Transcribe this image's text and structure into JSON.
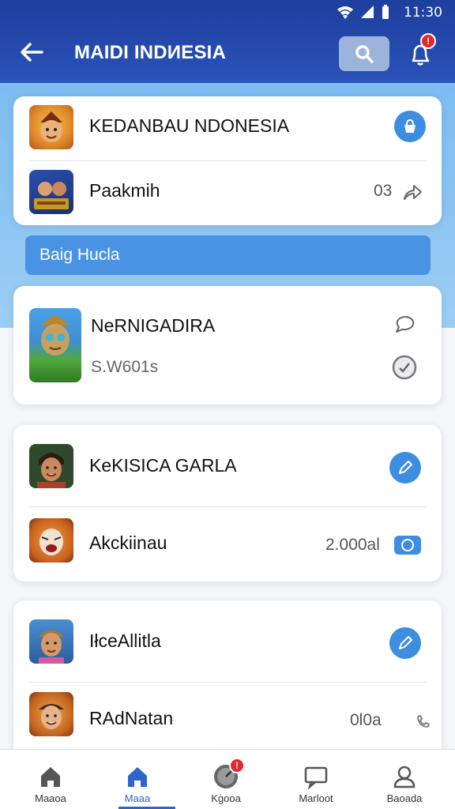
{
  "status_bar": {
    "time": "11:30"
  },
  "header": {
    "title": "MAIDI INDИESIA",
    "notification_count": "!"
  },
  "card1": {
    "rows": [
      {
        "title": "KEDANBAU NDONESIA",
        "value": ""
      },
      {
        "title": "Paakmih",
        "value": "03"
      }
    ]
  },
  "section": {
    "label": "Baig Hucla"
  },
  "card2": {
    "rows": [
      {
        "title": "NeRNIGADIRA",
        "value": ""
      },
      {
        "title": "S.W601s",
        "value": ""
      }
    ]
  },
  "card3": {
    "rows": [
      {
        "title": "KeKISICA GARLA",
        "value": ""
      },
      {
        "title": "Akckiinau",
        "value": "2.000al"
      }
    ]
  },
  "card4": {
    "rows": [
      {
        "title": "IłceAllitla",
        "value": ""
      },
      {
        "title": "RAdNatan",
        "value": "0l0a"
      }
    ]
  },
  "nav": {
    "items": [
      {
        "label": "Maaoa"
      },
      {
        "label": "Maaa"
      },
      {
        "label": "Kġooa",
        "badge": "!"
      },
      {
        "label": "Marloot"
      },
      {
        "label": "Baoada"
      }
    ]
  },
  "colors": {
    "header": "#1d3f9e",
    "accent": "#3d8de0",
    "band": "#7cbcf0",
    "badge": "#e5262b"
  }
}
